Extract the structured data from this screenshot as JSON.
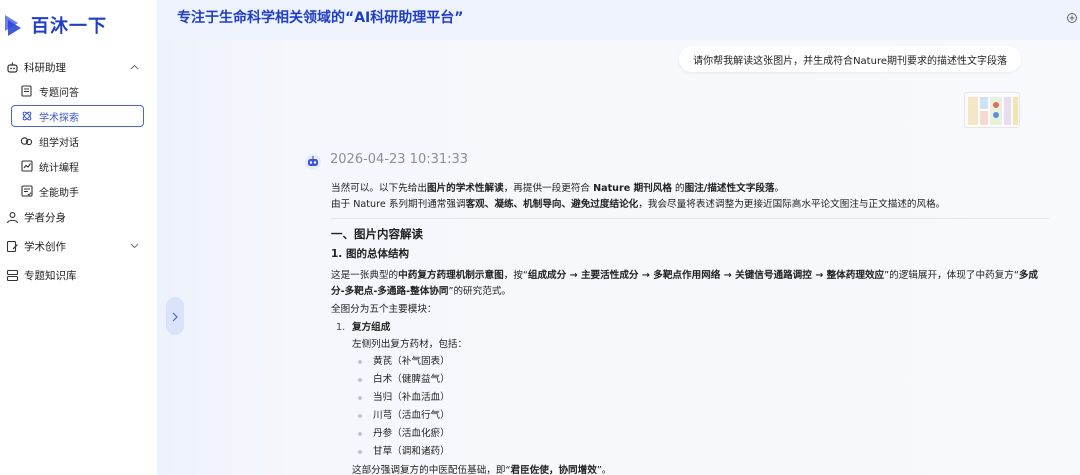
{
  "app": {
    "name": "百沐一下"
  },
  "header": {
    "title": "专注于生命科学相关领域的“AI科研助理平台”"
  },
  "sidebar": {
    "groups": [
      {
        "label": "科研助理",
        "icon": "robot-icon",
        "expanded": true,
        "items": [
          {
            "label": "专题问答",
            "icon": "document-icon"
          },
          {
            "label": "学术探索",
            "icon": "atom-icon",
            "active": true
          },
          {
            "label": "组学对话",
            "icon": "chat-icon"
          },
          {
            "label": "统计编程",
            "icon": "chart-icon"
          },
          {
            "label": "全能助手",
            "icon": "tasklist-icon"
          }
        ]
      },
      {
        "label": "学者分身",
        "icon": "people-icon"
      },
      {
        "label": "学术创作",
        "icon": "edit-icon",
        "expanded": false
      },
      {
        "label": "专题知识库",
        "icon": "database-icon"
      }
    ]
  },
  "chat": {
    "user_message": "请你帮我解读这张图片，并生成符合Nature期刊要求的描述性文字段落",
    "timestamp": "2026-04-23 10:31:33",
    "answer": {
      "intro_1": [
        "当然可以。以下先给出",
        "图片的学术性解读",
        "，再提供一段更符合 ",
        "Nature 期刊风格",
        " 的",
        "图注/描述性文字段落",
        "。"
      ],
      "intro_2": [
        "由于 Nature 系列期刊通常强调",
        "客观、凝练、机制导向、避免过度结论化",
        "，我会尽量将表述调整为更接近国际高水平论文图注与正文描述的风格。"
      ],
      "section_title": "一、图片内容解读",
      "subsection_title": "1. 图的总体结构",
      "para_1": [
        "这是一张典型的",
        "中药复方药理机制示意图",
        "，按“",
        "组成成分 → 主要活性成分 → 多靶点作用网络 → 关键信号通路调控 → 整体药理效应",
        "”的逻辑展开，体现了中药复方“",
        "多成分-多靶点-多通路-整体协同",
        "”的研究范式。"
      ],
      "para_2": "全图分为五个主要模块：",
      "list_1": {
        "num": "1.",
        "title": "复方组成",
        "desc": "左侧列出复方药材，包括：",
        "items": [
          "黄芪（补气固表）",
          "白术（健脾益气）",
          "当归（补血活血）",
          "川芎（活血行气）",
          "丹参（活血化瘀）",
          "甘草（调和诸药）"
        ],
        "note": [
          "这部分强调复方的中医配伍基础，即“",
          "君臣佐使，协同增效",
          "”。"
        ]
      }
    }
  },
  "colors": {
    "brand": "#1f3ec8",
    "accent": "#3b55d6",
    "active_border": "#4a63d8"
  }
}
